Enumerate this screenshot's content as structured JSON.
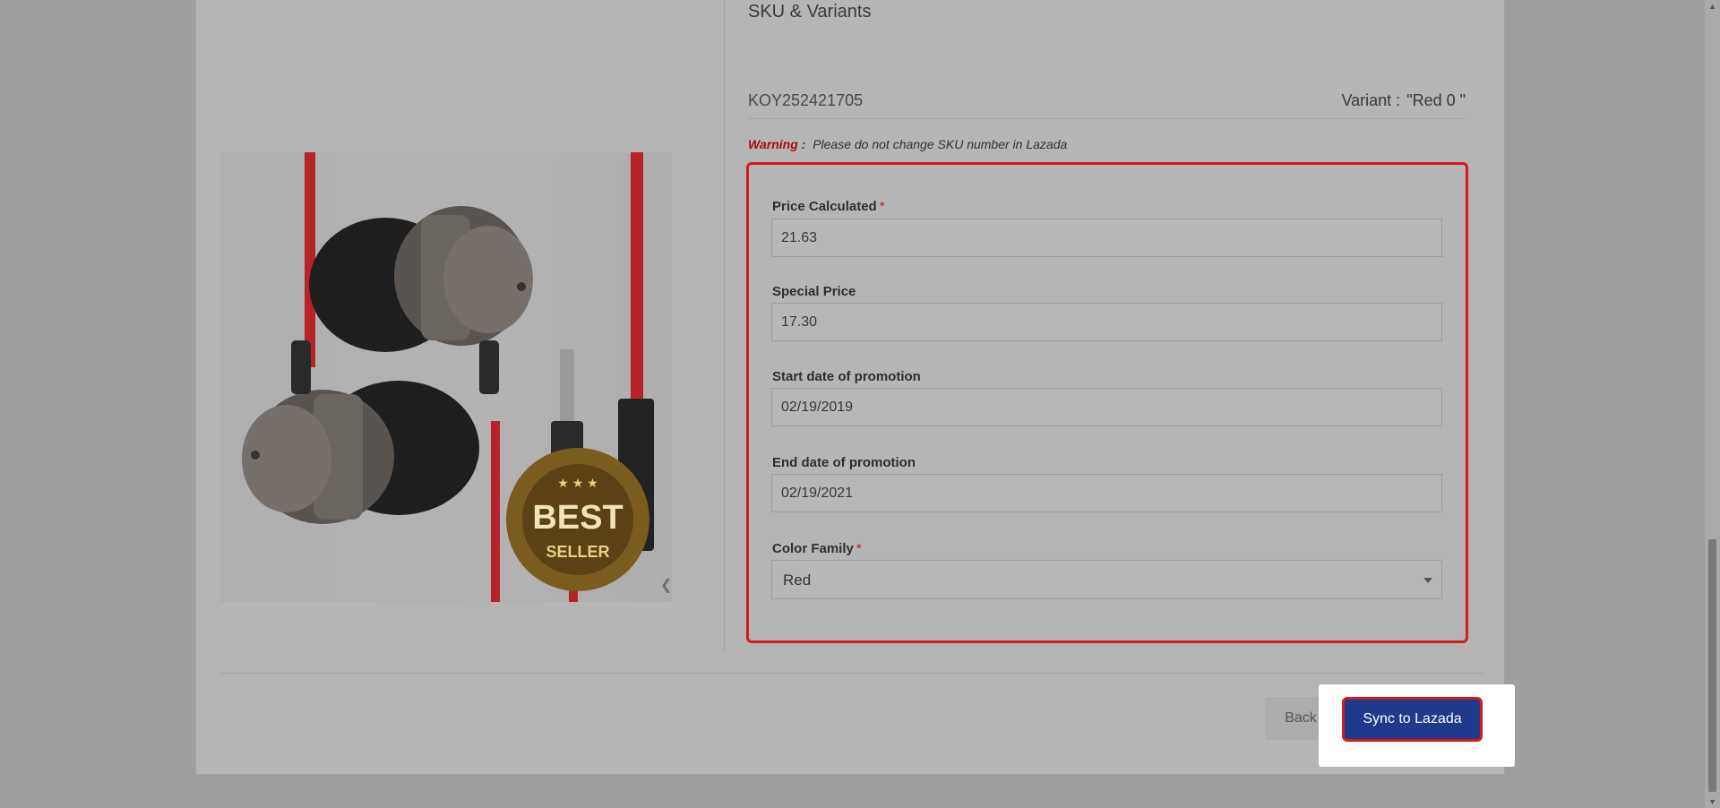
{
  "section": {
    "title": "SKU & Variants"
  },
  "sku": {
    "code": "KOY252421705",
    "variant_label": "Variant :",
    "variant_value": "\"Red 0 \""
  },
  "warning": {
    "label": "Warning :",
    "text": "Please do not change SKU number in Lazada"
  },
  "form": {
    "price_calculated": {
      "label": "Price Calculated",
      "required": "*",
      "value": "21.63"
    },
    "special_price": {
      "label": "Special Price",
      "value": "17.30"
    },
    "start_date": {
      "label": "Start date of promotion",
      "value": "02/19/2019"
    },
    "end_date": {
      "label": "End date of promotion",
      "value": "02/19/2021"
    },
    "color_family": {
      "label": "Color Family",
      "required": "*",
      "selected": "Red"
    }
  },
  "product_image": {
    "badge_top": "★ ★ ★",
    "badge_main": "BEST",
    "badge_sub": "SELLER"
  },
  "icons": {
    "carousel_prev": "chevron-left-icon",
    "select_arrow": "caret-down-icon"
  },
  "actions": {
    "back_label": "Back",
    "sync_label": "Sync to Lazada"
  },
  "colors": {
    "highlight": "#d11d1d",
    "primary": "#1d3b8a",
    "warning": "#a40e0e"
  }
}
